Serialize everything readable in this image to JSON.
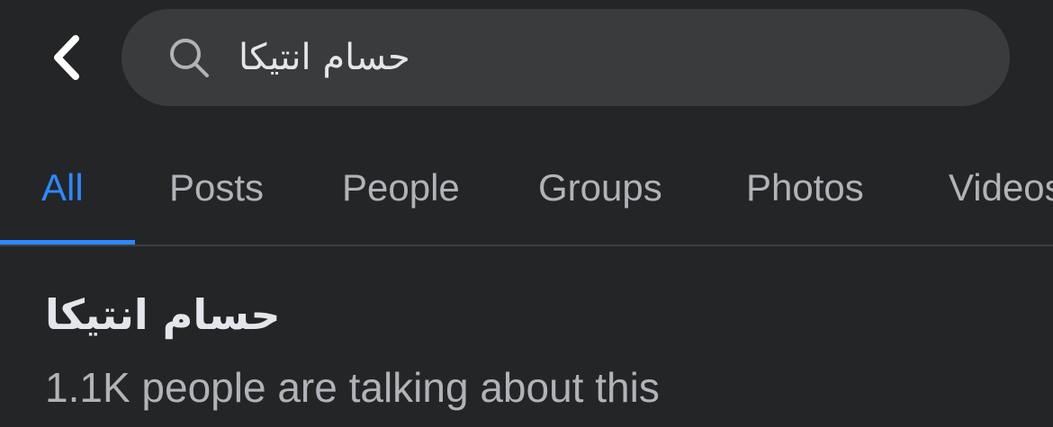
{
  "header": {
    "back_icon": "chevron-left-icon",
    "search": {
      "icon": "search-icon",
      "value": "حسام انتيكا",
      "placeholder": ""
    }
  },
  "tabs": [
    {
      "label": "All",
      "active": true
    },
    {
      "label": "Posts",
      "active": false
    },
    {
      "label": "People",
      "active": false
    },
    {
      "label": "Groups",
      "active": false
    },
    {
      "label": "Photos",
      "active": false
    },
    {
      "label": "Videos",
      "active": false
    }
  ],
  "result": {
    "title": "حسام انتيكا",
    "subtitle": "1.1K people are talking about this"
  },
  "colors": {
    "background": "#242526",
    "search_bg": "#3a3b3c",
    "accent": "#2d88ff",
    "primary_text": "#e4e6eb",
    "secondary_text": "#b0b3b8",
    "divider": "#3e4042"
  }
}
